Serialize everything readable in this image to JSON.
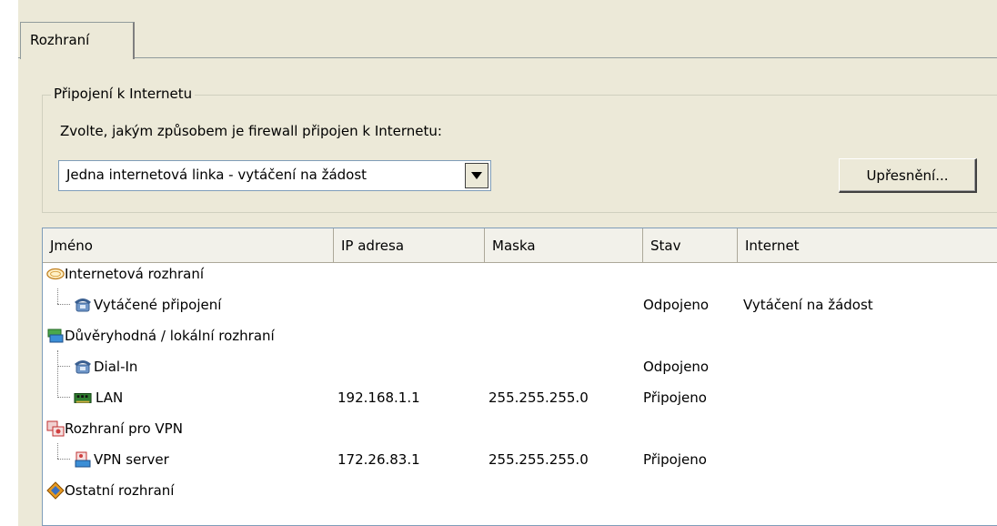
{
  "tabs": [
    {
      "label": "Rozhraní"
    }
  ],
  "internet_group": {
    "legend": "Připojení k Internetu",
    "prompt": "Zvolte, jakým způsobem je firewall připojen k Internetu:",
    "connection_mode": "Jedna internetová linka - vytáčení na žádost",
    "advanced_button": "Upřesnění..."
  },
  "table": {
    "columns": [
      "Jméno",
      "IP adresa",
      "Maska",
      "Stav",
      "Internet"
    ],
    "rows": [
      {
        "name": "Internetová rozhraní",
        "ip": "",
        "mask": "",
        "status": "",
        "internet": "",
        "icon": "cloud-icon"
      },
      {
        "name": "Vytáčené připojení",
        "ip": "",
        "mask": "",
        "status": "Odpojeno",
        "internet": "Vytáčení na žádost",
        "icon": "dialup-phone-icon"
      },
      {
        "name": "Důvěryhodná / lokální rozhraní",
        "ip": "",
        "mask": "",
        "status": "",
        "internet": "",
        "icon": "lan-group-icon"
      },
      {
        "name": "Dial-In",
        "ip": "",
        "mask": "",
        "status": "Odpojeno",
        "internet": "",
        "icon": "dialin-phone-icon"
      },
      {
        "name": "LAN",
        "ip": "192.168.1.1",
        "mask": "255.255.255.0",
        "status": "Připojeno",
        "internet": "",
        "icon": "network-card-icon"
      },
      {
        "name": "Rozhraní pro VPN",
        "ip": "",
        "mask": "",
        "status": "",
        "internet": "",
        "icon": "vpn-group-icon"
      },
      {
        "name": "VPN server",
        "ip": "172.26.83.1",
        "mask": "255.255.255.0",
        "status": "Připojeno",
        "internet": "",
        "icon": "vpn-server-icon"
      },
      {
        "name": "Ostatní rozhraní",
        "ip": "",
        "mask": "",
        "status": "",
        "internet": "",
        "icon": "other-interfaces-icon"
      }
    ]
  }
}
